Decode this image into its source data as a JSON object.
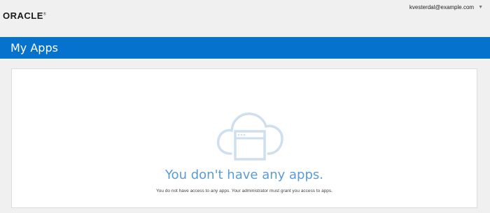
{
  "header": {
    "logo_text": "ORACLE",
    "logo_mark": "®",
    "user_email": "kvesterdal@example.com",
    "user_menu_icon": "caret-down-icon"
  },
  "titlebar": {
    "title": "My Apps",
    "color": "#0572ce"
  },
  "empty_state": {
    "icon": "cloud-app-window-icon",
    "title": "You don't have any apps.",
    "description": "You do not have access to any apps. Your administrator must grant you access to apps.",
    "accent_color": "#5b9bd5"
  }
}
